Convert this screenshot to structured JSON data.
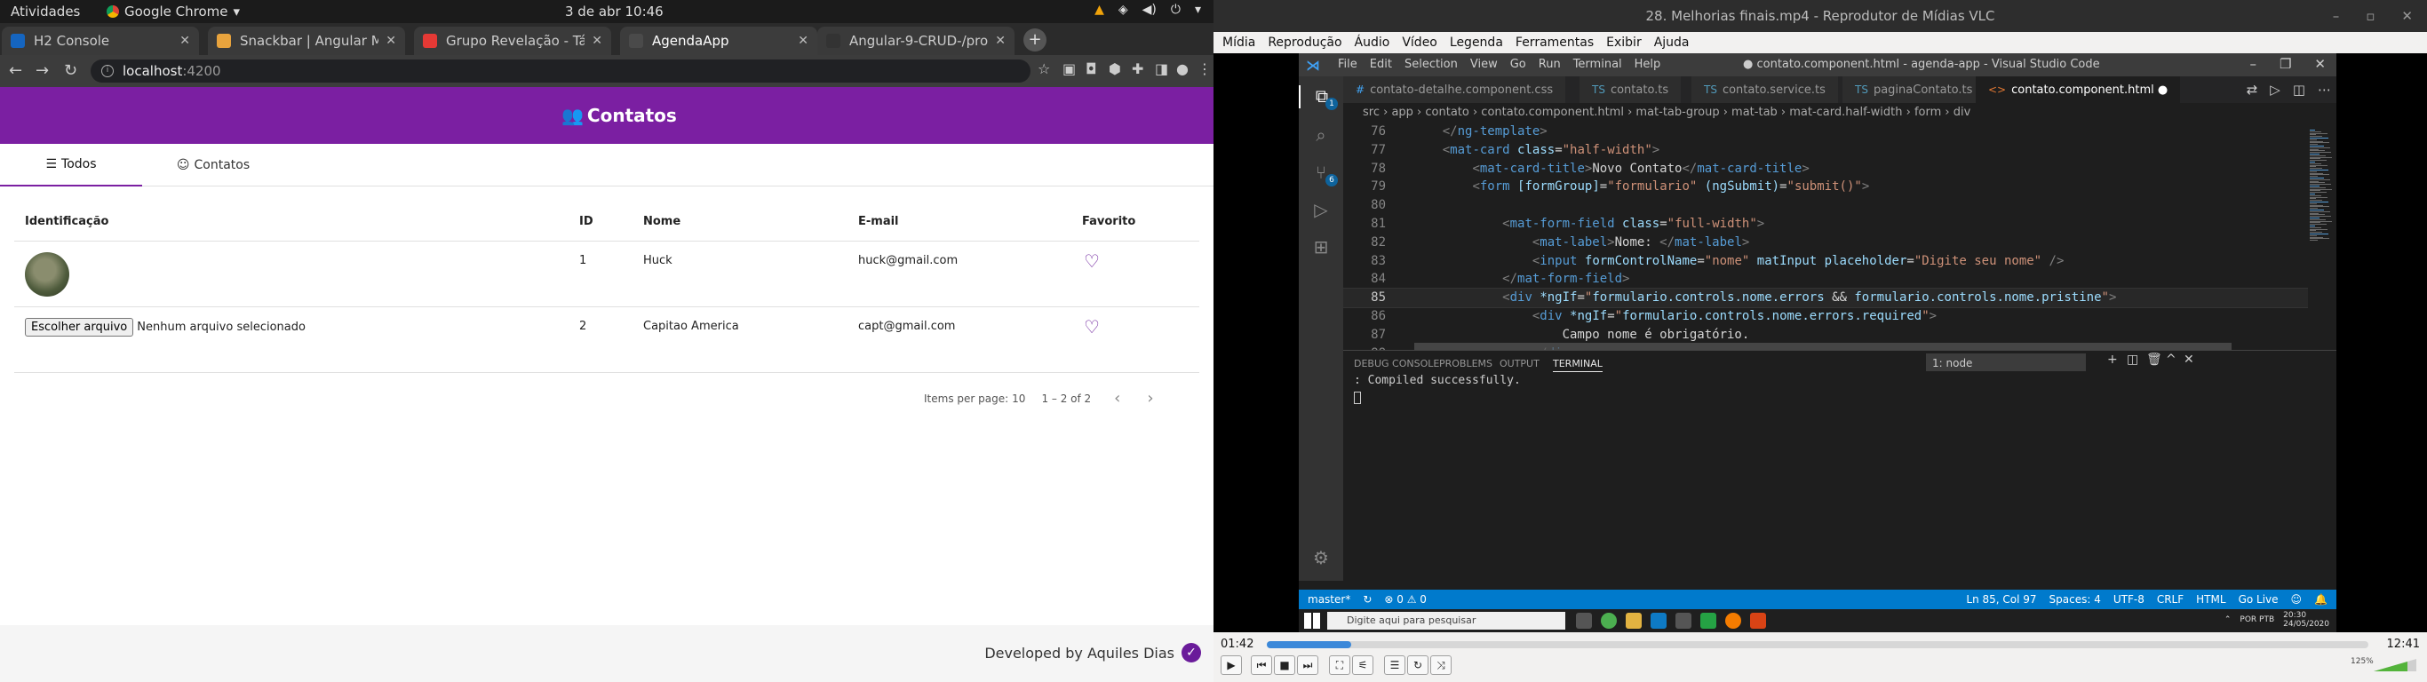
{
  "gnome": {
    "activities": "Atividades",
    "app": "Google Chrome",
    "clock": "3 de abr  10:46"
  },
  "chrome": {
    "tabs": [
      {
        "label": "H2 Console",
        "color": "#1565c0"
      },
      {
        "label": "Snackbar | Angular Mat",
        "color": "#e8a33d"
      },
      {
        "label": "Grupo Revelação - Tá Es",
        "color": "#e53935"
      },
      {
        "label": "AgendaApp",
        "color": "#4a4a4a"
      },
      {
        "label": "Angular-9-CRUD-/prod",
        "color": "#333333"
      }
    ],
    "url_host": "localhost",
    "url_port": ":4200"
  },
  "app": {
    "title": "Contatos",
    "tabs": [
      "Todos",
      "Contatos"
    ],
    "columns": [
      "Identificação",
      "ID",
      "Nome",
      "E-mail",
      "Favorito"
    ],
    "rows": [
      {
        "id": "1",
        "nome": "Huck",
        "email": "huck@gmail.com"
      },
      {
        "id": "2",
        "nome": "Capitao America",
        "email": "capt@gmail.com",
        "file_btn": "Escolher arquivo",
        "file_status": "Nenhum arquivo selecionado"
      }
    ],
    "paginator": {
      "label": "Items per page:",
      "size": "10",
      "range": "1 – 2 of 2"
    },
    "footer": "Developed by Aquiles Dias"
  },
  "vlc": {
    "title": "28. Melhorias finais.mp4 - Reprodutor de Mídias VLC",
    "menu": [
      "Mídia",
      "Reprodução",
      "Áudio",
      "Vídeo",
      "Legenda",
      "Ferramentas",
      "Exibir",
      "Ajuda"
    ],
    "time_current": "01:42",
    "time_total": "12:41",
    "progress": 0.077,
    "volume": "125%"
  },
  "vscode": {
    "menus": [
      "File",
      "Edit",
      "Selection",
      "View",
      "Go",
      "Run",
      "Terminal",
      "Help"
    ],
    "doc_title": "● contato.component.html - agenda-app - Visual Studio Code",
    "tabs": [
      {
        "label": "contato-detalhe.component.css",
        "type": "css"
      },
      {
        "label": "contato.ts",
        "type": "ts"
      },
      {
        "label": "contato.service.ts",
        "type": "ts"
      },
      {
        "label": "paginaContato.ts",
        "type": "ts"
      },
      {
        "label": "contato.component.html ●",
        "type": "html"
      }
    ],
    "breadcrumbs": "src › app › contato › contato.component.html › mat-tab-group › mat-tab › mat-card.half-width › form › div",
    "panel_tabs": [
      "DEBUG CONSOLE",
      "PROBLEMS",
      "OUTPUT",
      "TERMINAL"
    ],
    "terminal_select": "1: node",
    "terminal_text": ": Compiled successfully.",
    "status_left": [
      "master*",
      "⊗ 0 ⚠ 0"
    ],
    "status_right": [
      "Ln 85, Col 97",
      "Spaces: 4",
      "UTF-8",
      "CRLF",
      "HTML",
      "Go Live"
    ],
    "taskbar_search": "Digite aqui para pesquisar",
    "taskbar_time": "20:30",
    "taskbar_date": "24/05/2020",
    "taskbar_lang": "POR PTB"
  }
}
